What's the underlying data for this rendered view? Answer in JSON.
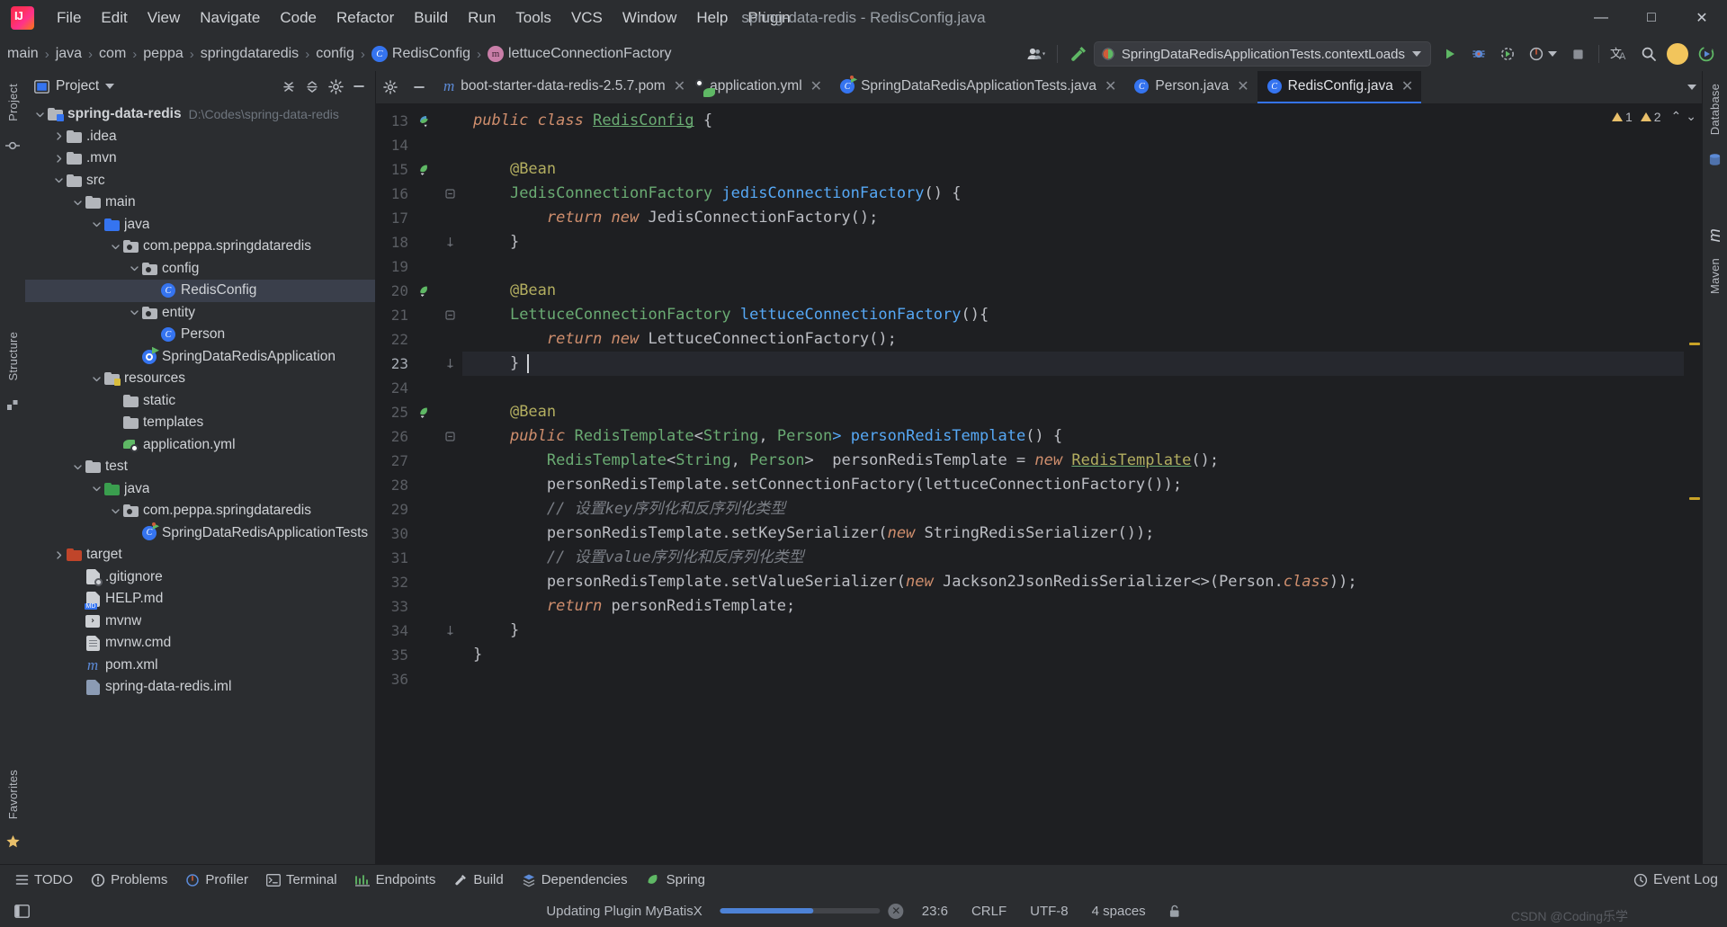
{
  "window": {
    "title": "spring-data-redis - RedisConfig.java",
    "logo_icon": "intellij-idea-logo",
    "minimize_icon": "minimize-icon",
    "maximize_icon": "maximize-icon",
    "close_icon": "close-icon"
  },
  "menu": {
    "items": [
      {
        "label": "File"
      },
      {
        "label": "Edit"
      },
      {
        "label": "View"
      },
      {
        "label": "Navigate"
      },
      {
        "label": "Code"
      },
      {
        "label": "Refactor"
      },
      {
        "label": "Build"
      },
      {
        "label": "Run"
      },
      {
        "label": "Tools"
      },
      {
        "label": "VCS"
      },
      {
        "label": "Window"
      },
      {
        "label": "Help"
      },
      {
        "label": "Plugin"
      }
    ]
  },
  "breadcrumb": {
    "items": [
      {
        "label": "main",
        "icon": ""
      },
      {
        "label": "java",
        "icon": ""
      },
      {
        "label": "com",
        "icon": ""
      },
      {
        "label": "peppa",
        "icon": ""
      },
      {
        "label": "springdataredis",
        "icon": ""
      },
      {
        "label": "config",
        "icon": ""
      },
      {
        "label": "RedisConfig",
        "icon": "class-icon"
      },
      {
        "label": "lettuceConnectionFactory",
        "icon": "method-icon"
      }
    ]
  },
  "toolbar": {
    "run_config": "SpringDataRedisApplicationTests.contextLoads",
    "run_config_icon": "run-config-icon",
    "dropdown_icon": "chevron-down-icon",
    "collaborate_icon": "collaborate-icon",
    "build_icon": "build-hammer-icon",
    "run_icon": "run-icon",
    "debug_icon": "debug-icon",
    "run_coverage_icon": "run-with-coverage-icon",
    "profiler_icon": "profiler-icon",
    "stop_icon": "stop-icon",
    "translate_icon": "translate-icon",
    "search_icon": "search-icon",
    "account_icon": "account-avatar",
    "updates_icon": "updates-icon"
  },
  "project_panel": {
    "title": "Project",
    "title_dropdown_icon": "chevron-down-icon",
    "collapse_icon": "collapse-all-icon",
    "expand_icon": "expand-all-icon",
    "settings_icon": "gear-icon",
    "hide_icon": "hide-panel-icon",
    "tree": [
      {
        "label": "spring-data-redis",
        "sub": "D:\\Codes\\spring-data-redis",
        "indent": 0,
        "arrow": "down",
        "icon": "module-folder-icon",
        "bold": true
      },
      {
        "label": ".idea",
        "sub": "",
        "indent": 1,
        "arrow": "right",
        "icon": "folder-icon",
        "bold": false
      },
      {
        "label": ".mvn",
        "sub": "",
        "indent": 1,
        "arrow": "right",
        "icon": "folder-icon",
        "bold": false
      },
      {
        "label": "src",
        "sub": "",
        "indent": 1,
        "arrow": "down",
        "icon": "folder-icon",
        "bold": false
      },
      {
        "label": "main",
        "sub": "",
        "indent": 2,
        "arrow": "down",
        "icon": "folder-icon",
        "bold": false
      },
      {
        "label": "java",
        "sub": "",
        "indent": 3,
        "arrow": "down",
        "icon": "source-root-icon",
        "bold": false
      },
      {
        "label": "com.peppa.springdataredis",
        "sub": "",
        "indent": 4,
        "arrow": "down",
        "icon": "package-icon",
        "bold": false
      },
      {
        "label": "config",
        "sub": "",
        "indent": 5,
        "arrow": "down",
        "icon": "package-icon",
        "bold": false
      },
      {
        "label": "RedisConfig",
        "sub": "",
        "indent": 6,
        "arrow": "none",
        "icon": "java-class-icon",
        "bold": false,
        "selected": true
      },
      {
        "label": "entity",
        "sub": "",
        "indent": 5,
        "arrow": "down",
        "icon": "package-icon",
        "bold": false
      },
      {
        "label": "Person",
        "sub": "",
        "indent": 6,
        "arrow": "none",
        "icon": "java-class-icon",
        "bold": false
      },
      {
        "label": "SpringDataRedisApplication",
        "sub": "",
        "indent": 5,
        "arrow": "none",
        "icon": "spring-boot-class-icon",
        "bold": false
      },
      {
        "label": "resources",
        "sub": "",
        "indent": 3,
        "arrow": "down",
        "icon": "resource-root-icon",
        "bold": false
      },
      {
        "label": "static",
        "sub": "",
        "indent": 4,
        "arrow": "none",
        "icon": "folder-icon",
        "bold": false
      },
      {
        "label": "templates",
        "sub": "",
        "indent": 4,
        "arrow": "none",
        "icon": "folder-icon",
        "bold": false
      },
      {
        "label": "application.yml",
        "sub": "",
        "indent": 4,
        "arrow": "none",
        "icon": "spring-yaml-icon",
        "bold": false
      },
      {
        "label": "test",
        "sub": "",
        "indent": 2,
        "arrow": "down",
        "icon": "folder-icon",
        "bold": false
      },
      {
        "label": "java",
        "sub": "",
        "indent": 3,
        "arrow": "down",
        "icon": "test-source-root-icon",
        "bold": false
      },
      {
        "label": "com.peppa.springdataredis",
        "sub": "",
        "indent": 4,
        "arrow": "down",
        "icon": "package-icon",
        "bold": false
      },
      {
        "label": "SpringDataRedisApplicationTests",
        "sub": "",
        "indent": 5,
        "arrow": "none",
        "icon": "test-class-icon",
        "bold": false
      },
      {
        "label": "target",
        "sub": "",
        "indent": 1,
        "arrow": "right",
        "icon": "excluded-folder-icon",
        "bold": false
      },
      {
        "label": ".gitignore",
        "sub": "",
        "indent": 2,
        "arrow": "none",
        "icon": "gitignore-file-icon",
        "bold": false
      },
      {
        "label": "HELP.md",
        "sub": "",
        "indent": 2,
        "arrow": "none",
        "icon": "markdown-file-icon",
        "bold": false
      },
      {
        "label": "mvnw",
        "sub": "",
        "indent": 2,
        "arrow": "none",
        "icon": "shell-script-icon",
        "bold": false
      },
      {
        "label": "mvnw.cmd",
        "sub": "",
        "indent": 2,
        "arrow": "none",
        "icon": "cmd-file-icon",
        "bold": false
      },
      {
        "label": "pom.xml",
        "sub": "",
        "indent": 2,
        "arrow": "none",
        "icon": "maven-pom-icon",
        "bold": false
      },
      {
        "label": "spring-data-redis.iml",
        "sub": "",
        "indent": 2,
        "arrow": "none",
        "icon": "iml-file-icon",
        "bold": false
      }
    ]
  },
  "left_strip": {
    "tabs": [
      "Project",
      "Structure",
      "Favorites"
    ],
    "bookmark_icon": "bookmark-star-icon",
    "commit_icon": "commit-icon"
  },
  "right_strip": {
    "tabs": [
      "Database",
      "m",
      "Maven"
    ]
  },
  "editor": {
    "gear_icon": "gear-icon",
    "hide_icon": "hide-panel-icon",
    "tabs": [
      {
        "label": "boot-starter-data-redis-2.5.7.pom",
        "icon": "maven-pom-icon",
        "active": false
      },
      {
        "label": "application.yml",
        "icon": "spring-yaml-icon",
        "active": false
      },
      {
        "label": "SpringDataRedisApplicationTests.java",
        "icon": "test-class-icon",
        "active": false
      },
      {
        "label": "Person.java",
        "icon": "java-class-icon",
        "active": false
      },
      {
        "label": "RedisConfig.java",
        "icon": "java-class-icon",
        "active": true
      }
    ],
    "tabs_overflow_icon": "chevron-down-icon",
    "warnings": {
      "warning_count": "1",
      "weak_warning_count": "2",
      "up_icon": "chevron-up-icon",
      "down_icon": "chevron-down-icon"
    },
    "first_line_number": 13,
    "current_line": 23,
    "lines": [
      {
        "n": 13,
        "gutter_icon": "spring-bean-icon",
        "fold": "none",
        "tokens": [
          {
            "t": "public ",
            "c": "kw2"
          },
          {
            "t": "class ",
            "c": "kw2"
          },
          {
            "t": "RedisConfig",
            "c": "cls warnsq undl"
          },
          {
            "t": " {",
            "c": "ident"
          }
        ]
      },
      {
        "n": 14,
        "gutter_icon": "",
        "fold": "none",
        "tokens": []
      },
      {
        "n": 15,
        "gutter_icon": "spring-bean-method-icon",
        "fold": "none",
        "tokens": [
          {
            "t": "    ",
            "c": "ident"
          },
          {
            "t": "@Bean",
            "c": "ann2"
          }
        ]
      },
      {
        "n": 16,
        "gutter_icon": "",
        "fold": "open",
        "tokens": [
          {
            "t": "    ",
            "c": "ident"
          },
          {
            "t": "JedisConnectionFactory",
            "c": "type"
          },
          {
            "t": " jedisConnectionFactory",
            "c": "methodname"
          },
          {
            "t": "() {",
            "c": "ident"
          }
        ]
      },
      {
        "n": 17,
        "gutter_icon": "",
        "fold": "none",
        "tokens": [
          {
            "t": "        ",
            "c": "ident"
          },
          {
            "t": "return ",
            "c": "kw2"
          },
          {
            "t": "new ",
            "c": "kw2"
          },
          {
            "t": "JedisConnectionFactory",
            "c": "ident"
          },
          {
            "t": "();",
            "c": "ident"
          }
        ]
      },
      {
        "n": 18,
        "gutter_icon": "",
        "fold": "close",
        "tokens": [
          {
            "t": "    }",
            "c": "ident"
          }
        ]
      },
      {
        "n": 19,
        "gutter_icon": "",
        "fold": "none",
        "tokens": []
      },
      {
        "n": 20,
        "gutter_icon": "spring-bean-method-icon",
        "fold": "none",
        "tokens": [
          {
            "t": "    ",
            "c": "ident"
          },
          {
            "t": "@Bean",
            "c": "ann2"
          }
        ]
      },
      {
        "n": 21,
        "gutter_icon": "",
        "fold": "open",
        "tokens": [
          {
            "t": "    ",
            "c": "ident"
          },
          {
            "t": "LettuceConnectionFactory",
            "c": "type"
          },
          {
            "t": " lettuceConnectionFactory",
            "c": "methodname"
          },
          {
            "t": "(){",
            "c": "ident"
          }
        ]
      },
      {
        "n": 22,
        "gutter_icon": "",
        "fold": "none",
        "tokens": [
          {
            "t": "        ",
            "c": "ident"
          },
          {
            "t": "return ",
            "c": "kw2"
          },
          {
            "t": "new ",
            "c": "kw2"
          },
          {
            "t": "LettuceConnectionFactory",
            "c": "ident"
          },
          {
            "t": "();",
            "c": "ident"
          }
        ]
      },
      {
        "n": 23,
        "gutter_icon": "",
        "fold": "close",
        "current": true,
        "tokens": [
          {
            "t": "    }",
            "c": "ident"
          }
        ]
      },
      {
        "n": 24,
        "gutter_icon": "",
        "fold": "none",
        "tokens": []
      },
      {
        "n": 25,
        "gutter_icon": "spring-bean-method-icon",
        "fold": "none",
        "tokens": [
          {
            "t": "    ",
            "c": "ident"
          },
          {
            "t": "@Bean",
            "c": "ann2"
          }
        ]
      },
      {
        "n": 26,
        "gutter_icon": "",
        "fold": "open",
        "tokens": [
          {
            "t": "    ",
            "c": "ident"
          },
          {
            "t": "public ",
            "c": "kw2"
          },
          {
            "t": "RedisTemplate",
            "c": "type"
          },
          {
            "t": "<",
            "c": "ident"
          },
          {
            "t": "String",
            "c": "type"
          },
          {
            "t": ", ",
            "c": "ident"
          },
          {
            "t": "Person",
            "c": "type"
          },
          {
            "t": "> personRedisTemplate",
            "c": "methodname"
          },
          {
            "t": "() {",
            "c": "ident"
          }
        ]
      },
      {
        "n": 27,
        "gutter_icon": "",
        "fold": "none",
        "tokens": [
          {
            "t": "        ",
            "c": "ident"
          },
          {
            "t": "RedisTemplate",
            "c": "type"
          },
          {
            "t": "<",
            "c": "ident"
          },
          {
            "t": "String",
            "c": "type"
          },
          {
            "t": ", ",
            "c": "ident"
          },
          {
            "t": "Person",
            "c": "type"
          },
          {
            "t": ">  personRedisTemplate = ",
            "c": "ident"
          },
          {
            "t": "new ",
            "c": "kw2"
          },
          {
            "t": "RedisTemplate",
            "c": "ann undl"
          },
          {
            "t": "();",
            "c": "ident"
          }
        ]
      },
      {
        "n": 28,
        "gutter_icon": "",
        "fold": "none",
        "tokens": [
          {
            "t": "        personRedisTemplate.",
            "c": "ident"
          },
          {
            "t": "setConnectionFactory",
            "c": "ident"
          },
          {
            "t": "(lettuceConnectionFactory());",
            "c": "ident"
          }
        ]
      },
      {
        "n": 29,
        "gutter_icon": "",
        "fold": "none",
        "tokens": [
          {
            "t": "        // 设置key序列化和反序列化类型",
            "c": "cmt"
          }
        ]
      },
      {
        "n": 30,
        "gutter_icon": "",
        "fold": "none",
        "tokens": [
          {
            "t": "        personRedisTemplate.setKeySerializer(",
            "c": "ident"
          },
          {
            "t": "new ",
            "c": "kw2"
          },
          {
            "t": "StringRedisSerializer",
            "c": "ident"
          },
          {
            "t": "());",
            "c": "ident"
          }
        ]
      },
      {
        "n": 31,
        "gutter_icon": "",
        "fold": "none",
        "tokens": [
          {
            "t": "        // 设置value序列化和反序列化类型",
            "c": "cmt"
          }
        ]
      },
      {
        "n": 32,
        "gutter_icon": "",
        "fold": "none",
        "tokens": [
          {
            "t": "        personRedisTemplate.setValueSerializer(",
            "c": "ident"
          },
          {
            "t": "new ",
            "c": "kw2"
          },
          {
            "t": "Jackson2JsonRedisSerializer",
            "c": "ident"
          },
          {
            "t": "<>(",
            "c": "ident"
          },
          {
            "t": "Person",
            "c": "ident"
          },
          {
            "t": ".",
            "c": "ident"
          },
          {
            "t": "class",
            "c": "kw2"
          },
          {
            "t": "));",
            "c": "ident"
          }
        ]
      },
      {
        "n": 33,
        "gutter_icon": "",
        "fold": "none",
        "tokens": [
          {
            "t": "        ",
            "c": "ident"
          },
          {
            "t": "return ",
            "c": "kw2"
          },
          {
            "t": "personRedisTemplate;",
            "c": "ident"
          }
        ]
      },
      {
        "n": 34,
        "gutter_icon": "",
        "fold": "close",
        "tokens": [
          {
            "t": "    }",
            "c": "ident"
          }
        ]
      },
      {
        "n": 35,
        "gutter_icon": "",
        "fold": "none",
        "tokens": [
          {
            "t": "}",
            "c": "ident"
          }
        ]
      },
      {
        "n": 36,
        "gutter_icon": "",
        "fold": "none",
        "tokens": []
      }
    ]
  },
  "bottom_bar": {
    "items": [
      {
        "label": "TODO",
        "icon": "todo-icon"
      },
      {
        "label": "Problems",
        "icon": "problems-icon"
      },
      {
        "label": "Profiler",
        "icon": "profiler-icon"
      },
      {
        "label": "Terminal",
        "icon": "terminal-icon"
      },
      {
        "label": "Endpoints",
        "icon": "endpoints-icon"
      },
      {
        "label": "Build",
        "icon": "build-hammer-icon"
      },
      {
        "label": "Dependencies",
        "icon": "dependencies-icon"
      },
      {
        "label": "Spring",
        "icon": "spring-leaf-icon"
      }
    ],
    "event_log": {
      "label": "Event Log",
      "icon": "event-log-icon"
    }
  },
  "status_bar": {
    "left_icon": "show-tool-windows-icon",
    "task_text": "Updating Plugin MyBatisX",
    "progress_percent": 58,
    "stop_icon": "stop-task-icon",
    "caret_position": "23:6",
    "line_separator": "CRLF",
    "encoding": "UTF-8",
    "indent": "4 spaces",
    "lock_icon": "unlocked-icon",
    "watermark": "CSDN @Coding乐学"
  },
  "colors": {
    "bg": "#2b2d30",
    "editor_bg": "#1e1f22",
    "accent": "#3574f0",
    "selection": "#3a3f4b",
    "keyword": "#cf8e6d",
    "type": "#6aab73",
    "comment": "#7a7e85",
    "annotation": "#b3ae60",
    "run_green": "#59a869",
    "warning": "#e8bf6a"
  }
}
